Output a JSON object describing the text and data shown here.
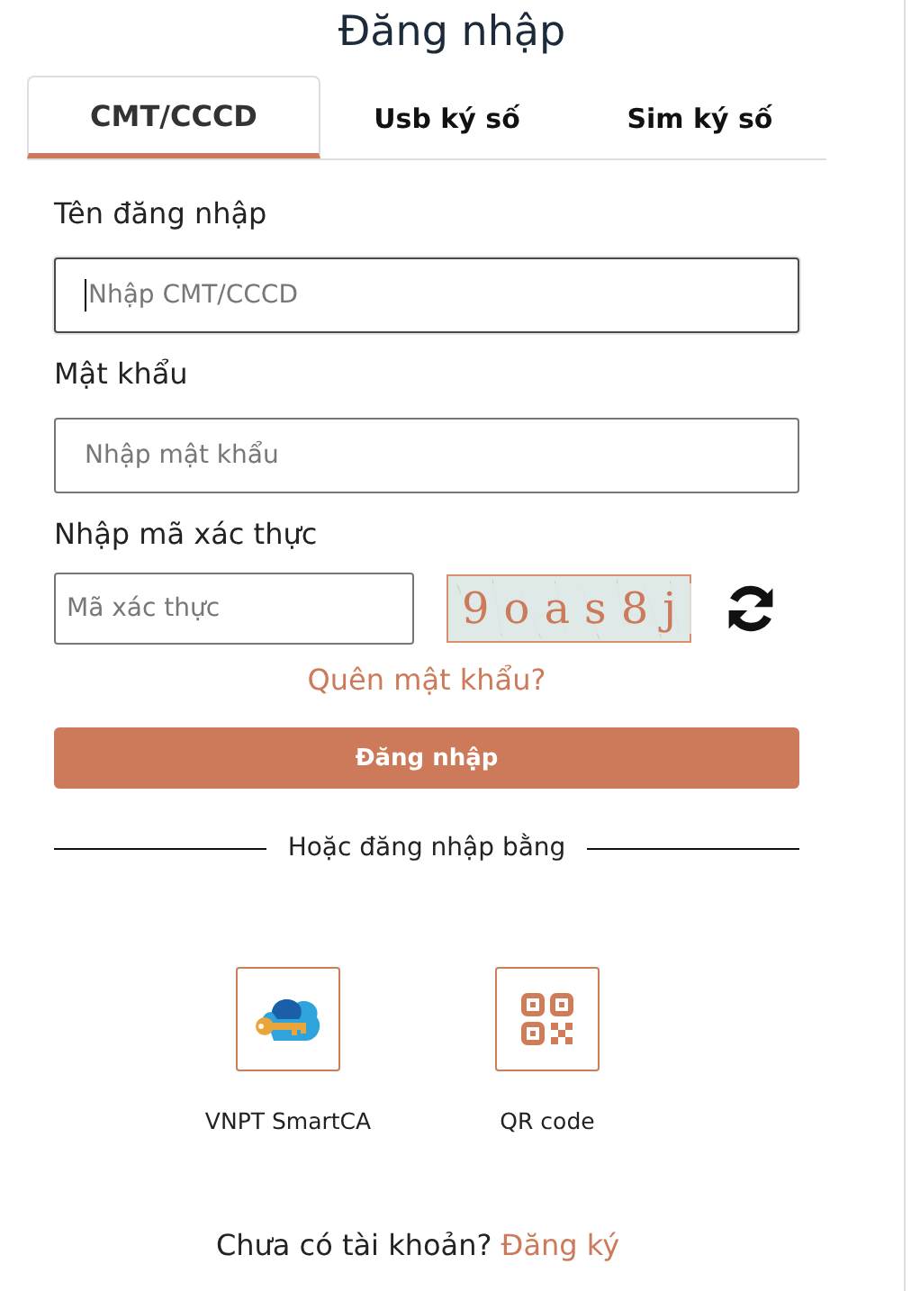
{
  "title": "Đăng nhập",
  "tabs": [
    {
      "label": "CMT/CCCD",
      "selected": true
    },
    {
      "label": "Usb ký số",
      "selected": false
    },
    {
      "label": "Sim ký số",
      "selected": false
    }
  ],
  "fields": [
    {
      "label": "Tên đăng nhập",
      "placeholder": "Nhập CMT/CCCD",
      "focused": true
    },
    {
      "label": "Mật khẩu",
      "placeholder": "Nhập mật khẩu",
      "focused": false
    }
  ],
  "captcha": {
    "label": "Nhập mã xác thực",
    "placeholder": "Mã xác thực",
    "code": "9oas8j"
  },
  "forgot_link": "Quên mật khẩu?",
  "login_button": "Đăng nhập",
  "divider_text": "Hoặc đăng nhập bằng",
  "alt_methods": [
    {
      "kind": "smartca",
      "label": "VNPT SmartCA"
    },
    {
      "kind": "qr",
      "label": "QR code"
    }
  ],
  "signup": {
    "prompt": "Chưa có tài khoản?",
    "link": "Đăng ký"
  }
}
